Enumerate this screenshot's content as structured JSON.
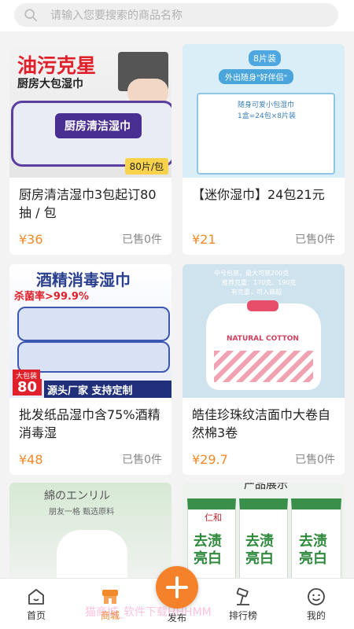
{
  "search": {
    "placeholder": "请输入您要搜索的商品名称"
  },
  "products": [
    {
      "title": "厨房清洁湿巾3包起订80抽 / 包",
      "price": "¥36",
      "sold": "已售0件",
      "image_texts": {
        "headline": "油污克星",
        "sub": "厨房大包湿巾",
        "pack": "厨房清洁湿巾",
        "badge": "80片/包"
      }
    },
    {
      "title": "【迷你湿巾】24包21元",
      "price": "¥21",
      "sold": "已售0件",
      "image_texts": {
        "tag": "8片装",
        "sub": "外出随身\"好伴侣\"",
        "box": "随身可爱小包湿巾",
        "box_sub": "1盒=24包×8片装"
      }
    },
    {
      "title": "批发纸品湿巾含75%酒精消毒湿",
      "price": "¥48",
      "sold": "已售0件",
      "image_texts": {
        "headline": "酒精消毒湿巾",
        "kill": "杀菌率>99.9%",
        "badge_top": "大包装",
        "badge_num": "80",
        "slogan": "源头厂家 支持定制"
      }
    },
    {
      "title": "皓佳珍珠纹洁面巾大卷自然棉3卷",
      "price": "¥29.7",
      "sold": "已售0件",
      "image_texts": {
        "note": "中号包装，最大可装200克",
        "note2": "推荐克重：170克、190克",
        "note3": "有克重，可入商超",
        "label": "NATURAL COTTON"
      }
    },
    {
      "title": "",
      "price": "",
      "sold": "",
      "image_texts": {
        "top": "綿のエンリル",
        "sub": "朋友一格 甄选原料"
      }
    },
    {
      "title": "",
      "price": "",
      "sold": "",
      "image_texts": {
        "header": "产品展示",
        "word1": "去渍",
        "word2": "亮白",
        "brand": "仁和"
      }
    }
  ],
  "tabbar": {
    "home": "首页",
    "mall": "商城",
    "publish": "发布",
    "ranking": "排行榜",
    "mine": "我的"
  },
  "watermark": "猫商城_软件下载HHHMM",
  "colors": {
    "accent": "#f08a2a",
    "price": "#f08a2a"
  }
}
